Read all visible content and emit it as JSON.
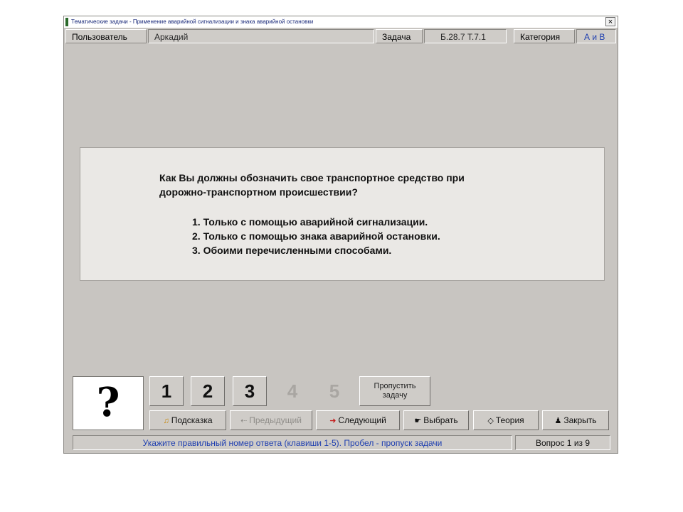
{
  "window": {
    "title": "Тематические задачи - Применение аварийной сигнализации и знака аварийной остановки",
    "close_glyph": "×"
  },
  "infobar": {
    "user_label": "Пользователь",
    "user_value": "Аркадий",
    "task_label": "Задача",
    "task_value": "Б.28.7  Т.7.1",
    "category_label": "Категория",
    "category_value": "А и В"
  },
  "question": {
    "lines": [
      "Как Вы должны обозначить свое транспортное средство при",
      "дорожно-транспортном происшествии?"
    ],
    "answers": [
      "1. Только с помощью аварийной сигнализации.",
      "2. Только с помощью знака аварийной остановки.",
      "3. Обоими перечисленными способами."
    ]
  },
  "image_placeholder": "?",
  "answer_buttons": [
    {
      "label": "1",
      "enabled": true
    },
    {
      "label": "2",
      "enabled": true
    },
    {
      "label": "3",
      "enabled": true
    },
    {
      "label": "4",
      "enabled": false
    },
    {
      "label": "5",
      "enabled": false
    }
  ],
  "skip_button": {
    "line1": "Пропустить",
    "line2": "задачу"
  },
  "actions": {
    "hint": "Подсказка",
    "prev": "Предыдущий",
    "next": "Следующий",
    "choose": "Выбрать",
    "theory": "Теория",
    "close": "Закрыть"
  },
  "icons": {
    "hint": "bell-icon",
    "prev": "arrow-left-icon",
    "next": "arrow-right-icon",
    "choose": "mouse-icon",
    "theory": "diamond-icon",
    "close": "person-icon"
  },
  "status": {
    "hint_text": "Укажите правильный номер ответа (клавиши 1-5). Пробел - пропуск задачи",
    "progress": "Вопрос 1 из 9"
  },
  "colors": {
    "window_bg": "#c8c5c1",
    "panel_bg": "#eae8e5",
    "status_text": "#1f3fb0"
  }
}
